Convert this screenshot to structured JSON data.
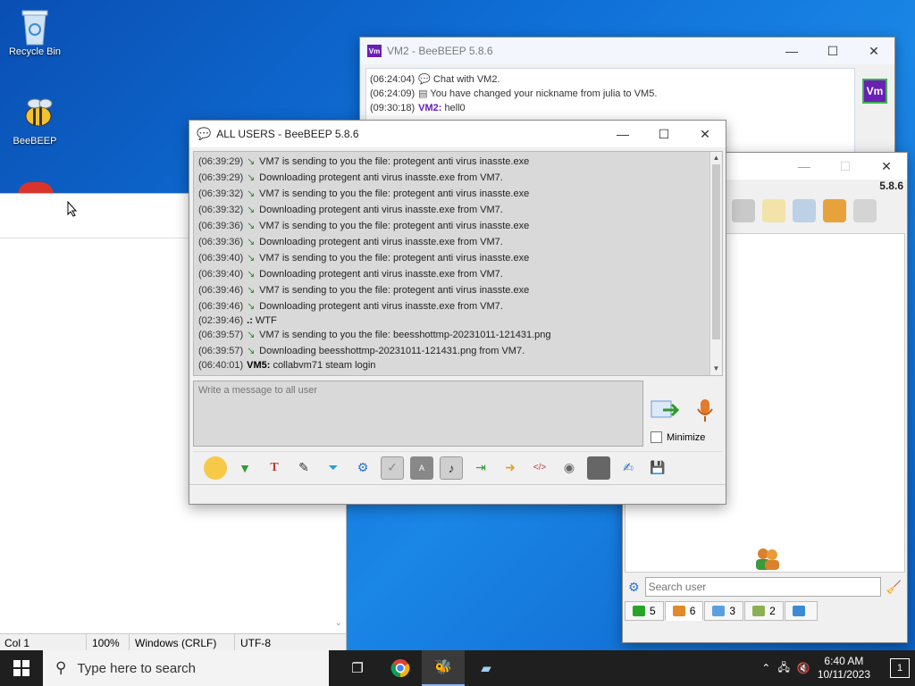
{
  "desktop": {
    "icons": [
      {
        "label": "Recycle Bin"
      },
      {
        "label": "BeeBEEP"
      }
    ]
  },
  "notepad": {
    "status": [
      "Col 1",
      "100%",
      "Windows (CRLF)",
      "UTF-8"
    ]
  },
  "vm2_window": {
    "title": "VM2 - BeeBEEP 5.8.6",
    "badge": "Vm",
    "messages": [
      {
        "time": "(06:24:04)",
        "text": "Chat with VM2."
      },
      {
        "time": "(06:24:09)",
        "text": "You have changed your nickname from julia to VM5."
      },
      {
        "time": "(09:30:18)",
        "nick": "VM2:",
        "text": "hell0"
      }
    ]
  },
  "main_window": {
    "version": "5.8.6",
    "search_placeholder": "Search user",
    "tabs": [
      {
        "count": "5"
      },
      {
        "count": "6"
      },
      {
        "count": "3"
      },
      {
        "count": "2"
      },
      {
        "count": ""
      }
    ]
  },
  "chat_window": {
    "title": "ALL USERS - BeeBEEP 5.8.6",
    "compose_placeholder": "Write a message to all user",
    "minimize_label": "Minimize",
    "log": [
      {
        "time": "(06:39:29)",
        "kind": "file",
        "text": "VM7 is sending to you the file: protegent anti virus inasste.exe"
      },
      {
        "time": "(06:39:29)",
        "kind": "file",
        "text": "Downloading protegent anti virus inasste.exe from VM7."
      },
      {
        "time": "(06:39:32)",
        "kind": "file",
        "text": "VM7 is sending to you the file: protegent anti virus inasste.exe"
      },
      {
        "time": "(06:39:32)",
        "kind": "file",
        "text": "Downloading protegent anti virus inasste.exe from VM7."
      },
      {
        "time": "(06:39:36)",
        "kind": "file",
        "text": "VM7 is sending to you the file: protegent anti virus inasste.exe"
      },
      {
        "time": "(06:39:36)",
        "kind": "file",
        "text": "Downloading protegent anti virus inasste.exe from VM7."
      },
      {
        "time": "(06:39:40)",
        "kind": "file",
        "text": "VM7 is sending to you the file: protegent anti virus inasste.exe"
      },
      {
        "time": "(06:39:40)",
        "kind": "file",
        "text": "Downloading protegent anti virus inasste.exe from VM7."
      },
      {
        "time": "(06:39:46)",
        "kind": "file",
        "text": "VM7 is sending to you the file: protegent anti virus inasste.exe"
      },
      {
        "time": "(06:39:46)",
        "kind": "file",
        "text": "Downloading protegent anti virus inasste.exe from VM7."
      },
      {
        "time": "(02:39:46)",
        "kind": "msg",
        "nick": ".:",
        "text": "WTF"
      },
      {
        "time": "(06:39:57)",
        "kind": "file",
        "text": "VM7 is sending to you the file: beesshottmp-20231011-121431.png"
      },
      {
        "time": "(06:39:57)",
        "kind": "file",
        "text": "Downloading beesshottmp-20231011-121431.png from VM7."
      },
      {
        "time": "(06:40:01)",
        "kind": "msg",
        "nick": "VM5:",
        "text": "collabvm71 steam login"
      }
    ]
  },
  "taskbar": {
    "search_placeholder": "Type here to search",
    "time": "6:40 AM",
    "date": "10/11/2023",
    "notifications": "1"
  },
  "colors": {
    "vm_badge": "#6a1fb5",
    "accent": "#0f6fd6"
  }
}
